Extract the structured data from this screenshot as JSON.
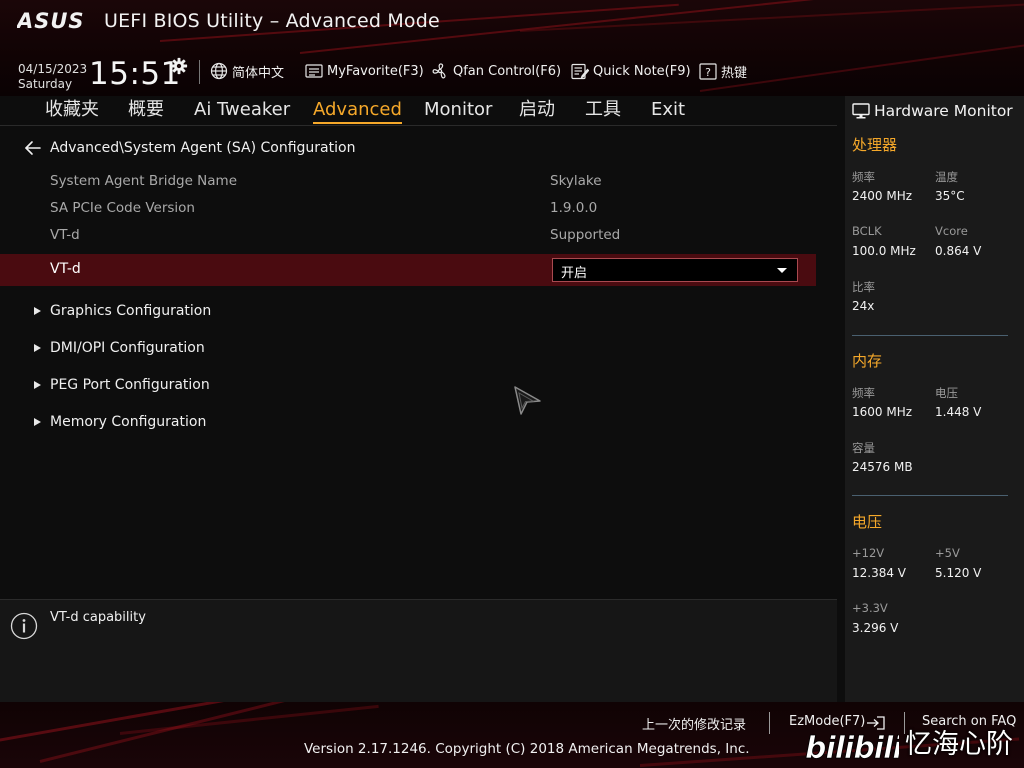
{
  "header": {
    "brand": "ASUS",
    "title": "UEFI BIOS Utility – Advanced Mode",
    "date": "04/15/2023",
    "day": "Saturday",
    "time": "15:51",
    "toolbar": {
      "language": "简体中文",
      "myfavorite": "MyFavorite(F3)",
      "qfan": "Qfan Control(F6)",
      "quicknote": "Quick Note(F9)",
      "hotkeys": "热键"
    }
  },
  "tabs": [
    {
      "label": "收藏夹"
    },
    {
      "label": "概要"
    },
    {
      "label": "Ai Tweaker"
    },
    {
      "label": "Advanced",
      "active": true
    },
    {
      "label": "Monitor"
    },
    {
      "label": "启动"
    },
    {
      "label": "工具"
    },
    {
      "label": "Exit"
    }
  ],
  "content": {
    "breadcrumb": "Advanced\\System Agent (SA) Configuration",
    "info_rows": [
      {
        "label": "System Agent Bridge Name",
        "value": "Skylake"
      },
      {
        "label": "SA PCIe Code Version",
        "value": "1.9.0.0"
      },
      {
        "label": "VT-d",
        "value": "Supported"
      }
    ],
    "vtd_setting": {
      "label": "VT-d",
      "value": "开启"
    },
    "submenus": [
      {
        "label": "Graphics Configuration"
      },
      {
        "label": "DMI/OPI Configuration"
      },
      {
        "label": "PEG Port Configuration"
      },
      {
        "label": "Memory Configuration"
      }
    ]
  },
  "help": {
    "text": "VT-d capability"
  },
  "hardware_monitor": {
    "title": "Hardware Monitor",
    "cpu": {
      "heading": "处理器",
      "freq_label": "频率",
      "freq": "2400 MHz",
      "temp_label": "温度",
      "temp": "35°C",
      "bclk_label": "BCLK",
      "bclk": "100.0 MHz",
      "vcore_label": "Vcore",
      "vcore": "0.864 V",
      "ratio_label": "比率",
      "ratio": "24x"
    },
    "memory": {
      "heading": "内存",
      "freq_label": "频率",
      "freq": "1600 MHz",
      "volt_label": "电压",
      "volt": "1.448 V",
      "cap_label": "容量",
      "cap": "24576 MB"
    },
    "voltage": {
      "heading": "电压",
      "v12_label": "+12V",
      "v12": "12.384 V",
      "v5_label": "+5V",
      "v5": "5.120 V",
      "v33_label": "+3.3V",
      "v33": "3.296 V"
    }
  },
  "footer": {
    "last_modified": "上一次的修改记录",
    "ezmode": "EzMode(F7)",
    "search_faq": "Search on FAQ",
    "copyright": "Version 2.17.1246. Copyright (C) 2018 American Megatrends, Inc."
  },
  "watermark": {
    "logo": "bilibili",
    "text": "忆海心阶"
  },
  "colors": {
    "accent": "#f5a82a",
    "highlight_row": "#4a0b10",
    "brand_red": "#8a1018"
  }
}
